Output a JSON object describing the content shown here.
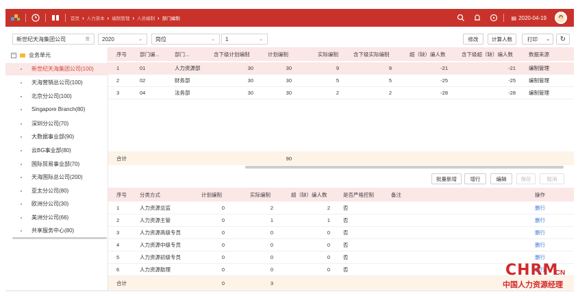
{
  "header": {
    "breadcrumbs": [
      "首页",
      "人力资本",
      "编制管理",
      "人员编制",
      "部门编制"
    ],
    "date": "2020-04-19",
    "accent": "#c8322b"
  },
  "filters": {
    "company": "新世纪天海集团公司",
    "year": "2020",
    "position": "岗位",
    "number": "1",
    "edit_label": "修改",
    "calc_label": "计算人数",
    "print_label": "打印"
  },
  "tree": {
    "root": "业务单元",
    "items": [
      "新世纪天海集团公司(100)",
      "天海营销总公司(100)",
      "北京分公司(100)",
      "Singapore Branch(80)",
      "深圳分公司(70)",
      "大数据事业部(90)",
      "云BG事业部(80)",
      "国际贸易事业部(70)",
      "天海国际总公司(200)",
      "亚太分公司(80)",
      "欧洲分公司(30)",
      "美洲分公司(66)",
      "共享服务中心(80)"
    ]
  },
  "upper_table": {
    "columns": [
      "序号",
      "部门编...",
      "部门...",
      "含下级计划编制",
      "计划编制",
      "实际编制",
      "含下级实际编制",
      "超（缺）编人数",
      "含下级超（缺）编人数",
      "数据来源"
    ],
    "rows": [
      [
        "1",
        "01",
        "人力资源部",
        "30",
        "30",
        "9",
        "9",
        "-21",
        "-21",
        "编制管理"
      ],
      [
        "2",
        "02",
        "财务部",
        "30",
        "30",
        "5",
        "5",
        "-25",
        "-25",
        "编制管理"
      ],
      [
        "3",
        "04",
        "法务部",
        "30",
        "30",
        "2",
        "2",
        "-28",
        "-28",
        "编制管理"
      ]
    ],
    "total_label": "合计",
    "total_plan": "90"
  },
  "actions": {
    "batch_add": "批量新增",
    "add_row": "增行",
    "edit": "编辑",
    "save": "保存",
    "cancel": "取消"
  },
  "lower_table": {
    "columns": [
      "序号",
      "分类方式",
      "计划编制",
      "实际编制",
      "超（缺）编人数",
      "是否严格控制",
      "备注",
      "操作"
    ],
    "rows": [
      [
        "1",
        "人力资源总监",
        "0",
        "2",
        "2",
        "否",
        "",
        "删行"
      ],
      [
        "2",
        "人力资源主管",
        "0",
        "1",
        "1",
        "否",
        "",
        "删行"
      ],
      [
        "3",
        "人力资源高级专员",
        "0",
        "0",
        "0",
        "否",
        "",
        "删行"
      ],
      [
        "4",
        "人力资源中级专员",
        "0",
        "0",
        "0",
        "否",
        "",
        "删行"
      ],
      [
        "5",
        "人力资源初级专员",
        "0",
        "0",
        "0",
        "否",
        "",
        "删行"
      ],
      [
        "6",
        "人力资源助理",
        "0",
        "0",
        "0",
        "否",
        "",
        "删行"
      ]
    ],
    "total_label": "合计",
    "total_plan": "0",
    "total_actual": "3"
  },
  "brand": {
    "logo_text": "CHRM",
    "logo_suffix": ".CN",
    "logo_sub": "中国人力资源经理"
  }
}
